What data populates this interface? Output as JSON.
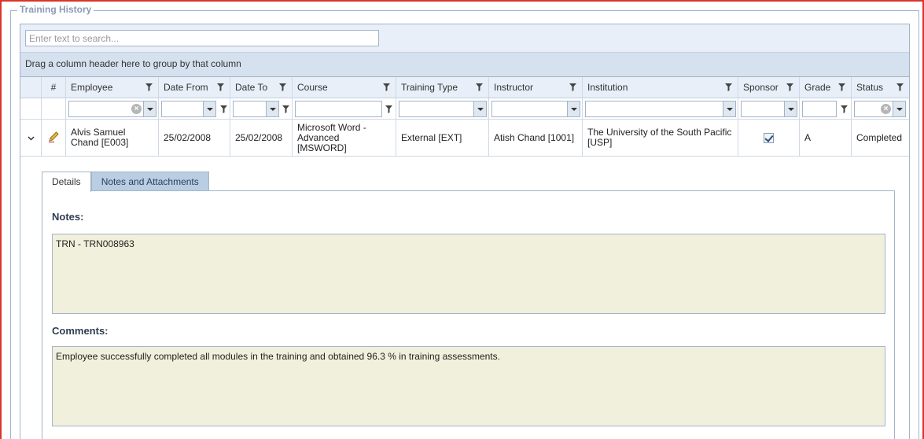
{
  "legend": "Training History",
  "search": {
    "placeholder": "Enter text to search..."
  },
  "group_panel": {
    "text": "Drag a column header here to group by that column"
  },
  "columns": {
    "num": "#",
    "employee": "Employee",
    "date_from": "Date From",
    "date_to": "Date To",
    "course": "Course",
    "training_type": "Training Type",
    "instructor": "Instructor",
    "institution": "Institution",
    "sponsor": "Sponsor",
    "grade": "Grade",
    "status": "Status"
  },
  "row": {
    "employee": "Alvis Samuel Chand [E003]",
    "date_from": "25/02/2008",
    "date_to": "25/02/2008",
    "course": "Microsoft Word - Advanced [MSWORD]",
    "training_type": "External [EXT]",
    "instructor": "Atish Chand [1001]",
    "institution": "The University of the South Pacific [USP]",
    "sponsor_checked": true,
    "grade": "A",
    "status": "Completed"
  },
  "detail": {
    "tabs": [
      "Details",
      "Notes and Attachments"
    ],
    "active_tab": "Details",
    "notes_label": "Notes:",
    "notes_value": "TRN - TRN008963",
    "comments_label": "Comments:",
    "comments_value": "Employee successfully completed all modules in the training and obtained 96.3 % in training assessments."
  },
  "colors": {
    "frame_border": "#d9362b",
    "header_bg": "#e8eff8",
    "group_panel_bg": "#d5e1ee",
    "memo_bg": "#f1f0dc",
    "inactive_tab_bg": "#b9cde3"
  }
}
